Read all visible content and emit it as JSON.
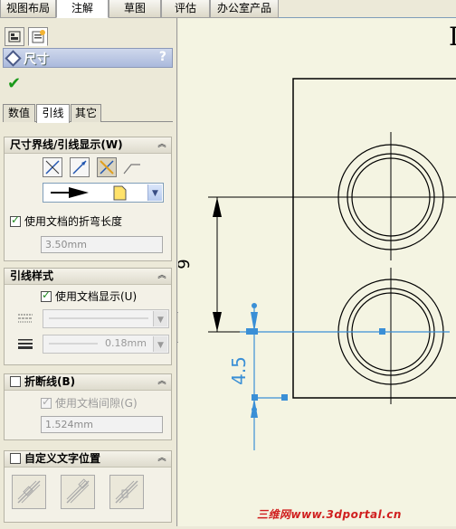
{
  "top_tabs": [
    {
      "label": "视图布局",
      "active": false
    },
    {
      "label": "注解",
      "active": true
    },
    {
      "label": "草图",
      "active": false
    },
    {
      "label": "评估",
      "active": false
    },
    {
      "label": "办公室产品",
      "active": false
    }
  ],
  "panel": {
    "title": "尺寸",
    "help": "?",
    "confirm": "✔",
    "sub_tabs": [
      "数值",
      "引线",
      "其它"
    ],
    "active_sub_tab": "引线"
  },
  "groups": {
    "leader_display": {
      "title": "尺寸界线/引线显示(W)",
      "use_doc_bend_label": "使用文档的折弯长度",
      "use_doc_bend_checked": true,
      "bend_length": "3.50mm"
    },
    "leader_style": {
      "title": "引线样式",
      "use_doc_display_label": "使用文档显示(U)",
      "use_doc_display_checked": true,
      "line_weight": "0.18mm"
    },
    "break_lines": {
      "title": "折断线(B)",
      "checked": false,
      "use_doc_gap_label": "使用文档间隙(G)",
      "use_doc_gap_checked": true,
      "gap": "1.524mm"
    },
    "custom_text_pos": {
      "title": "自定义文字位置",
      "checked": false
    }
  },
  "drawing": {
    "dim_vertical": "9",
    "dim_selected": "4.5",
    "corner_text": "I"
  },
  "watermark": "三维网www.3dportal.cn",
  "colors": {
    "selection_blue": "#3a8fd6",
    "panel_bg": "#ece9d8",
    "canvas_bg": "#f4f4e2"
  }
}
